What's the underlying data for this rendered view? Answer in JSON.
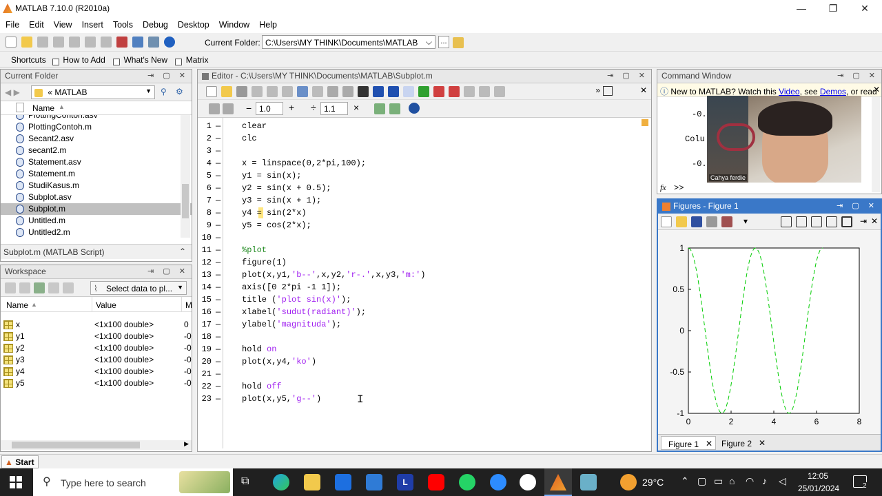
{
  "window": {
    "title": "MATLAB  7.10.0 (R2010a)"
  },
  "menu": [
    "File",
    "Edit",
    "View",
    "Insert",
    "Tools",
    "Debug",
    "Desktop",
    "Window",
    "Help"
  ],
  "toolbar": {
    "current_folder_label": "Current Folder:",
    "current_folder_value": "C:\\Users\\MY THINK\\Documents\\MATLAB",
    "browse": "..."
  },
  "shortcuts": {
    "shortcuts": "Shortcuts",
    "how_to_add": "How to Add",
    "whats_new": "What's New",
    "matrix": "Matrix"
  },
  "current_folder": {
    "title": "Current Folder",
    "path": "«  MATLAB",
    "name_header": "Name",
    "files": [
      "PlottingContoh.asv",
      "PlottingContoh.m",
      "Secant2.asv",
      "secant2.m",
      "Statement.asv",
      "Statement.m",
      "StudiKasus.m",
      "Subplot.asv",
      "Subplot.m",
      "Untitled.m",
      "Untitled2.m"
    ],
    "selected": "Subplot.m",
    "details": "Subplot.m (MATLAB Script)"
  },
  "workspace": {
    "title": "Workspace",
    "select_data": "Select data to pl...",
    "headers": {
      "name": "Name",
      "value": "Value",
      "min": "M"
    },
    "vars": [
      {
        "name": "x",
        "value": "<1x100 double>",
        "min": "0"
      },
      {
        "name": "y1",
        "value": "<1x100 double>",
        "min": "-0"
      },
      {
        "name": "y2",
        "value": "<1x100 double>",
        "min": "-0"
      },
      {
        "name": "y3",
        "value": "<1x100 double>",
        "min": "-0"
      },
      {
        "name": "y4",
        "value": "<1x100 double>",
        "min": "-0"
      },
      {
        "name": "y5",
        "value": "<1x100 double>",
        "min": "-0"
      }
    ]
  },
  "editor": {
    "title": "Editor - C:\\Users\\MY THINK\\Documents\\MATLAB\\Subplot.m",
    "cell_value1": "1.0",
    "cell_value2": "1.1",
    "lines": [
      {
        "n": "1",
        "segs": [
          {
            "t": "clear",
            "c": ""
          }
        ]
      },
      {
        "n": "2",
        "segs": [
          {
            "t": "clc",
            "c": ""
          }
        ]
      },
      {
        "n": "3",
        "segs": []
      },
      {
        "n": "4",
        "segs": [
          {
            "t": "x = linspace(0,2*pi,100);",
            "c": ""
          }
        ]
      },
      {
        "n": "5",
        "segs": [
          {
            "t": "y1 = sin(x);",
            "c": ""
          }
        ]
      },
      {
        "n": "6",
        "segs": [
          {
            "t": "y2 = sin(x + 0.5);",
            "c": ""
          }
        ]
      },
      {
        "n": "7",
        "segs": [
          {
            "t": "y3 = sin(x + 1);",
            "c": ""
          }
        ]
      },
      {
        "n": "8",
        "segs": [
          {
            "t": "y4 = sin(2*x)",
            "c": ""
          }
        ]
      },
      {
        "n": "9",
        "segs": [
          {
            "t": "y5 = cos(2*x);",
            "c": ""
          }
        ]
      },
      {
        "n": "10",
        "segs": []
      },
      {
        "n": "11",
        "segs": [
          {
            "t": "%plot",
            "c": "cmt"
          }
        ]
      },
      {
        "n": "12",
        "segs": [
          {
            "t": "figure(1)",
            "c": ""
          }
        ]
      },
      {
        "n": "13",
        "segs": [
          {
            "t": "plot(x,y1,",
            "c": ""
          },
          {
            "t": "'b--'",
            "c": "str"
          },
          {
            "t": ",x,y2,",
            "c": ""
          },
          {
            "t": "'r-.'",
            "c": "str"
          },
          {
            "t": ",x,y3,",
            "c": ""
          },
          {
            "t": "'m:'",
            "c": "str"
          },
          {
            "t": ")",
            "c": ""
          }
        ]
      },
      {
        "n": "14",
        "segs": [
          {
            "t": "axis([0 2*pi -1 1]);",
            "c": ""
          }
        ]
      },
      {
        "n": "15",
        "segs": [
          {
            "t": "title (",
            "c": ""
          },
          {
            "t": "'plot sin(x)'",
            "c": "str"
          },
          {
            "t": ");",
            "c": ""
          }
        ]
      },
      {
        "n": "16",
        "segs": [
          {
            "t": "xlabel(",
            "c": ""
          },
          {
            "t": "'sudut(radiant)'",
            "c": "str"
          },
          {
            "t": ");",
            "c": ""
          }
        ]
      },
      {
        "n": "17",
        "segs": [
          {
            "t": "ylabel(",
            "c": ""
          },
          {
            "t": "'magnituda'",
            "c": "str"
          },
          {
            "t": ");",
            "c": ""
          }
        ]
      },
      {
        "n": "18",
        "segs": []
      },
      {
        "n": "19",
        "segs": [
          {
            "t": "hold ",
            "c": ""
          },
          {
            "t": "on",
            "c": "str"
          }
        ]
      },
      {
        "n": "20",
        "segs": [
          {
            "t": "plot(x,y4,",
            "c": ""
          },
          {
            "t": "'ko'",
            "c": "str"
          },
          {
            "t": ")",
            "c": ""
          }
        ]
      },
      {
        "n": "21",
        "segs": []
      },
      {
        "n": "22",
        "segs": [
          {
            "t": "hold ",
            "c": ""
          },
          {
            "t": "off",
            "c": "str"
          }
        ]
      },
      {
        "n": "23",
        "segs": [
          {
            "t": "plot(x,y5,",
            "c": ""
          },
          {
            "t": "'g--'",
            "c": "str"
          },
          {
            "t": ")",
            "c": ""
          }
        ]
      }
    ]
  },
  "command_window": {
    "title": "Command Window",
    "banner_prefix": "New to MATLAB? Watch this ",
    "banner_video": "Video",
    "banner_mid": ", see ",
    "banner_demos": "Demos",
    "banner_suffix": ", or read",
    "out1": "-0.",
    "out2": "Colu",
    "out3": "-0.",
    "prompt": ">>",
    "fx": "fx"
  },
  "webcam": {
    "name": "Cahya ferdie"
  },
  "figure": {
    "title": "Figures - Figure 1",
    "tabs": [
      "Figure 1",
      "Figure 2"
    ],
    "chart_data": {
      "type": "line",
      "series": [
        {
          "values_fn": "cos(2x)",
          "color": "#00cc00",
          "style": "dashed"
        }
      ],
      "xlim": [
        0,
        8
      ],
      "ylim": [
        -1,
        1
      ],
      "xticks": [
        "0",
        "2",
        "4",
        "6",
        "8"
      ],
      "yticks": [
        "1",
        "0.5",
        "0",
        "-0.5",
        "-1"
      ]
    }
  },
  "start": {
    "label": "Start"
  },
  "taskbar": {
    "search": "Type here to search",
    "weather": "29°C",
    "time": "12:05",
    "date": "25/01/2024",
    "notif": "2"
  }
}
